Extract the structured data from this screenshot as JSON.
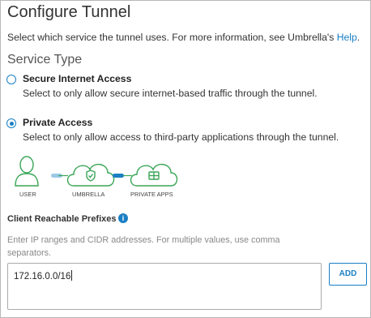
{
  "page": {
    "title": "Configure Tunnel",
    "intro_text": "Select which service the tunnel uses. For more information, see Umbrella's ",
    "intro_link": "Help",
    "intro_end": "."
  },
  "service_type": {
    "heading": "Service Type",
    "options": [
      {
        "label": "Secure Internet Access",
        "description": "Select to only allow secure internet-based traffic through the tunnel.",
        "selected": false
      },
      {
        "label": "Private Access",
        "description": "Select to only allow access to third-party applications through the tunnel.",
        "selected": true
      }
    ]
  },
  "diagram": {
    "labels": [
      "USER",
      "UMBRELLA",
      "PRIVATE APPS"
    ],
    "colors": {
      "stroke": "#3aa657",
      "link_active": "#1a7fc4",
      "link_inactive": "#9cc9e6"
    },
    "icons": [
      "user-icon",
      "umbrella-shield-icon",
      "private-apps-icon"
    ]
  },
  "prefixes": {
    "label": "Client Reachable Prefixes",
    "info_glyph": "i",
    "help": "Enter IP ranges and CIDR addresses. For multiple values, use comma separators.",
    "value": "172.16.0.0/16",
    "add_label": "ADD"
  },
  "colors": {
    "accent": "#1a7fc4",
    "text": "#333333",
    "muted": "#888888"
  }
}
